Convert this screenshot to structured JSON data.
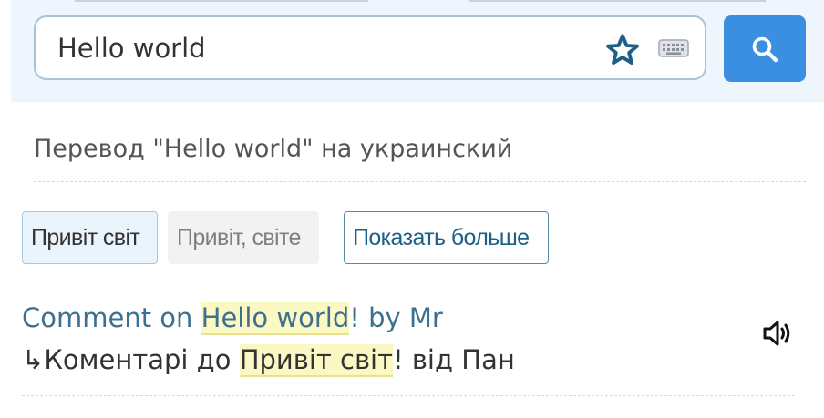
{
  "search": {
    "value": "Hello world",
    "icons": {
      "favorite": "star-icon",
      "keyboard": "keyboard-icon",
      "submit": "search-icon"
    }
  },
  "heading": {
    "title": "Перевод \"Hello world\" на украинский"
  },
  "translations": [
    {
      "label": "Привіт світ",
      "state": "selected"
    },
    {
      "label": "Привіт, світе",
      "state": "alternative"
    },
    {
      "label": "Показать больше",
      "state": "action"
    }
  ],
  "example": {
    "source": {
      "before": "Comment on ",
      "highlight": "Hello world",
      "after": "! by Mr"
    },
    "target": {
      "arrow": "↳",
      "before": "Коментарі до ",
      "highlight": "Привіт світ",
      "after": "! від Пан"
    },
    "audio_icon": "speaker-icon"
  },
  "colors": {
    "accent": "#3b8fe0",
    "link": "#3d7090",
    "highlight": "#fbf8c4",
    "star": "#1e5f85"
  }
}
